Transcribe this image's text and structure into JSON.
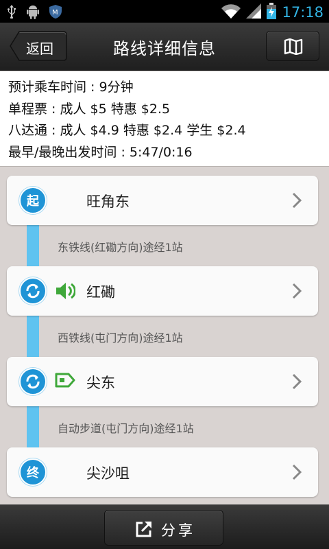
{
  "status_bar": {
    "time": "17:18",
    "left_icons": [
      "usb-icon",
      "android-icon",
      "shield-app-icon"
    ],
    "right_icons": [
      "wifi-icon",
      "signal-icon",
      "battery-charging-icon"
    ]
  },
  "header": {
    "back_label": "返回",
    "title": "路线详细信息",
    "map_icon": "map-icon"
  },
  "info": {
    "lines": [
      "预计乘车时间 : 9分钟",
      "单程票 : 成人 $5  特惠 $2.5",
      "八达通 : 成人 $4.9  特惠 $2.4  学生 $2.4",
      "最早/最晚出发时间 : 5:47/0:16"
    ]
  },
  "route": {
    "stations": [
      {
        "name": "旺角东",
        "badge": "起"
      },
      {
        "name": "红磡",
        "badge": ""
      },
      {
        "name": "尖东",
        "badge": ""
      },
      {
        "name": "尖沙咀",
        "badge": "终"
      }
    ],
    "segments": [
      "东铁线(红磡方向)途经1站",
      "西铁线(屯门方向)途经1站",
      "自动步道(屯门方向)途经1站"
    ]
  },
  "footer": {
    "share_label": "分享"
  },
  "colors": {
    "accent_blue": "#1f94d6",
    "rail_blue": "#5fc3f0",
    "green_icon": "#3fa83a",
    "time_blue": "#33b5e5"
  }
}
